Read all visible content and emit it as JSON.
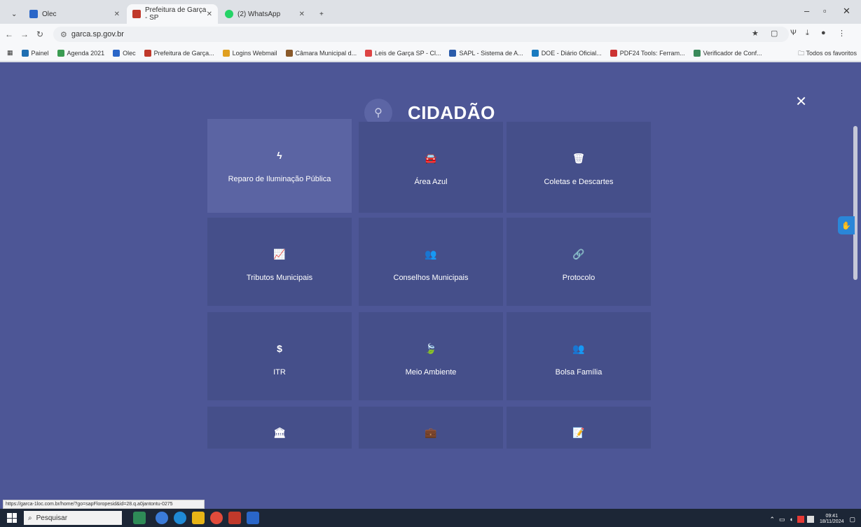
{
  "browser": {
    "tabs": [
      {
        "title": "Olec",
        "icon_color": "#2a66c8"
      },
      {
        "title": "Prefeitura de Garça - SP",
        "icon_color": "#c0392b"
      },
      {
        "title": "(2) WhatsApp",
        "icon_color": "#25d366"
      }
    ],
    "new_tab": "+",
    "url": "garca.sp.gov.br",
    "bookmarks": [
      "Painel",
      "Agenda 2021",
      "Olec",
      "Prefeitura de Garça...",
      "Logins Webmail",
      "Câmara Municipal d...",
      "Leis de Garça SP - Cl...",
      "SAPL - Sistema de A...",
      "DOE - Diário Oficial...",
      "PDF24 Tools: Ferram...",
      "Verificador de Conf..."
    ],
    "all_favorites": "Todos os favoritos"
  },
  "page": {
    "title": "CIDADÃO",
    "title_icon": "user-icon",
    "close_glyph": "×",
    "tiles": [
      {
        "label": "Reparo de Iluminação Pública",
        "icon": "bolt-icon",
        "glyph": "ϟ"
      },
      {
        "label": "Área Azul",
        "icon": "car-icon",
        "glyph": "🚘"
      },
      {
        "label": "Coletas e Descartes",
        "icon": "trash-icon",
        "glyph": "🗑"
      },
      {
        "label": "Tributos Municipais",
        "icon": "chart-icon",
        "glyph": "📈"
      },
      {
        "label": "Conselhos Municipais",
        "icon": "users-icon",
        "glyph": "👥"
      },
      {
        "label": "Protocolo",
        "icon": "link-icon",
        "glyph": "🔗"
      },
      {
        "label": "ITR",
        "icon": "dollar-icon",
        "glyph": "$"
      },
      {
        "label": "Meio Ambiente",
        "icon": "leaf-icon",
        "glyph": "🍃"
      },
      {
        "label": "Bolsa Família",
        "icon": "users-icon",
        "glyph": "👥"
      },
      {
        "label": "",
        "icon": "bank-icon",
        "glyph": "🏛"
      },
      {
        "label": "",
        "icon": "briefcase-icon",
        "glyph": "💼"
      },
      {
        "label": "",
        "icon": "edit-icon",
        "glyph": "📝"
      }
    ]
  },
  "status_url": "https://garca-1loc.com.br/home/?go=sapFloropesid&id=28.q.a0jantontu-0275",
  "taskbar": {
    "search_placeholder": "Pesquisar",
    "clock_time": "09:41",
    "clock_date": "18/11/2024"
  }
}
